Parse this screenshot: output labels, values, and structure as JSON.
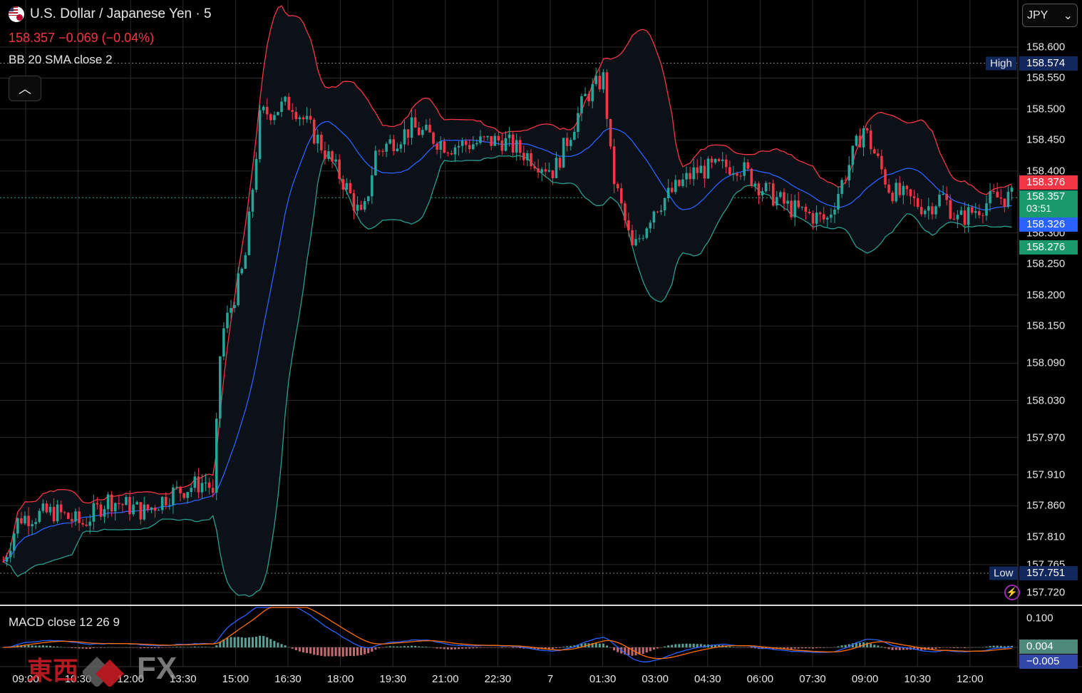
{
  "header": {
    "symbol_title": "U.S. Dollar / Japanese Yen · 5",
    "price_line": "158.357  −0.069 (−0.04%)",
    "indicator_bb": "BB 20 SMA close 2",
    "indicator_macd": "MACD close 12 26 9",
    "collapse_icon": "chevron-up-icon",
    "flag_icon": "usd-jpy-flag-icon"
  },
  "currency_select": {
    "value": "JPY",
    "chevron": "⌄"
  },
  "price_axis": {
    "labels": [
      "158.600",
      "158.550",
      "158.500",
      "158.450",
      "158.400",
      "158.300",
      "158.250",
      "158.200",
      "158.150",
      "158.090",
      "158.030",
      "157.970",
      "157.910",
      "157.860",
      "157.810",
      "157.765",
      "157.720"
    ],
    "macd_label": "0.100"
  },
  "tags": {
    "high_name": "High",
    "high_value": "158.574",
    "bb_upper": "158.376",
    "last_price": "158.357",
    "countdown": "03:51",
    "bb_basis": "158.326",
    "bb_lower": "158.276",
    "low_name": "Low",
    "low_value": "157.751",
    "macd_value": "0.004",
    "signal_value": "−0.005"
  },
  "time_axis": [
    "09:00",
    "10:30",
    "12:00",
    "13:30",
    "15:00",
    "16:30",
    "18:00",
    "19:30",
    "21:00",
    "22:30",
    "7",
    "01:30",
    "03:00",
    "04:30",
    "06:00",
    "07:30",
    "09:00",
    "10:30",
    "12:00"
  ],
  "watermark": {
    "chinese": "東西",
    "fx": "FX"
  },
  "colors": {
    "up": "#26a69a",
    "down": "#f23645",
    "bb_upper": "#f23645",
    "bb_lower": "#2a9d8f",
    "bb_basis": "#2962ff",
    "macd": "#2962ff",
    "signal": "#ff6d00",
    "grid": "#2a2a2a"
  },
  "chart_data": {
    "type": "candlestick",
    "symbol": "U.S. Dollar / Japanese Yen",
    "interval": "5",
    "ylim": [
      157.72,
      158.6
    ],
    "x_ticks": [
      "09:00",
      "10:30",
      "12:00",
      "13:30",
      "15:00",
      "16:30",
      "18:00",
      "19:30",
      "21:00",
      "22:30",
      "7",
      "01:30",
      "03:00",
      "04:30",
      "06:00",
      "07:30",
      "09:00",
      "10:30",
      "12:00"
    ],
    "close_path": [
      {
        "t": 0,
        "v": 157.77
      },
      {
        "t": 0.3,
        "v": 157.84
      },
      {
        "t": 1,
        "v": 157.85
      },
      {
        "t": 1.5,
        "v": 157.83
      },
      {
        "t": 2,
        "v": 157.87
      },
      {
        "t": 2.7,
        "v": 157.85
      },
      {
        "t": 3.2,
        "v": 157.88
      },
      {
        "t": 3.9,
        "v": 157.9
      },
      {
        "t": 4.0,
        "v": 157.87
      },
      {
        "t": 4.15,
        "v": 158.13
      },
      {
        "t": 4.6,
        "v": 158.25
      },
      {
        "t": 4.9,
        "v": 158.49
      },
      {
        "t": 5.5,
        "v": 158.51
      },
      {
        "t": 6.0,
        "v": 158.45
      },
      {
        "t": 6.5,
        "v": 158.38
      },
      {
        "t": 6.85,
        "v": 158.32
      },
      {
        "t": 7.1,
        "v": 158.43
      },
      {
        "t": 7.8,
        "v": 158.47
      },
      {
        "t": 8.5,
        "v": 158.44
      },
      {
        "t": 9.5,
        "v": 158.45
      },
      {
        "t": 10.5,
        "v": 158.4
      },
      {
        "t": 11.1,
        "v": 158.52
      },
      {
        "t": 11.45,
        "v": 158.55
      },
      {
        "t": 11.6,
        "v": 158.4
      },
      {
        "t": 12.0,
        "v": 158.27
      },
      {
        "t": 12.4,
        "v": 158.34
      },
      {
        "t": 13.2,
        "v": 158.4
      },
      {
        "t": 14.0,
        "v": 158.41
      },
      {
        "t": 14.5,
        "v": 158.37
      },
      {
        "t": 15.0,
        "v": 158.34
      },
      {
        "t": 15.7,
        "v": 158.32
      },
      {
        "t": 16.4,
        "v": 158.47
      },
      {
        "t": 16.9,
        "v": 158.37
      },
      {
        "t": 17.6,
        "v": 158.34
      },
      {
        "t": 17.9,
        "v": 158.36
      },
      {
        "t": 18.2,
        "v": 158.32
      },
      {
        "t": 18.9,
        "v": 158.357
      }
    ],
    "bollinger": {
      "period": 20,
      "stddev": 2,
      "upper": 158.376,
      "basis": 158.326,
      "lower": 158.276
    },
    "high": 158.574,
    "low": 157.751,
    "last": 158.357,
    "change": -0.069,
    "change_pct": -0.04,
    "macd": {
      "fast": 12,
      "slow": 26,
      "signal": 9,
      "macd": 0.004,
      "signal_value": -0.005
    }
  }
}
